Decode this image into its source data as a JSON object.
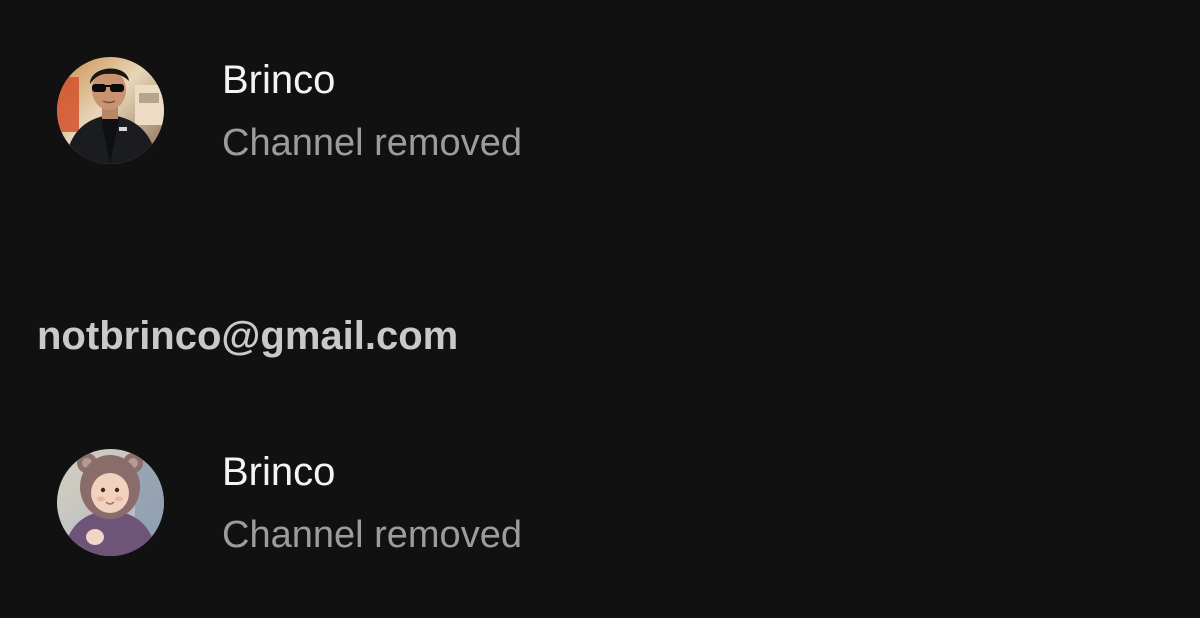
{
  "groups": [
    {
      "email": "",
      "accounts": [
        {
          "name": "Brinco",
          "status": "Channel removed",
          "avatar_icon": "person-sunglasses-avatar"
        }
      ]
    },
    {
      "email": "notbrinco@gmail.com",
      "accounts": [
        {
          "name": "Brinco",
          "status": "Channel removed",
          "avatar_icon": "baby-bear-hat-avatar"
        }
      ]
    }
  ],
  "colors": {
    "background": "#111112",
    "name_text": "#f4f4f4",
    "status_text": "#9c9c9e",
    "email_text": "#c9c9cb"
  }
}
